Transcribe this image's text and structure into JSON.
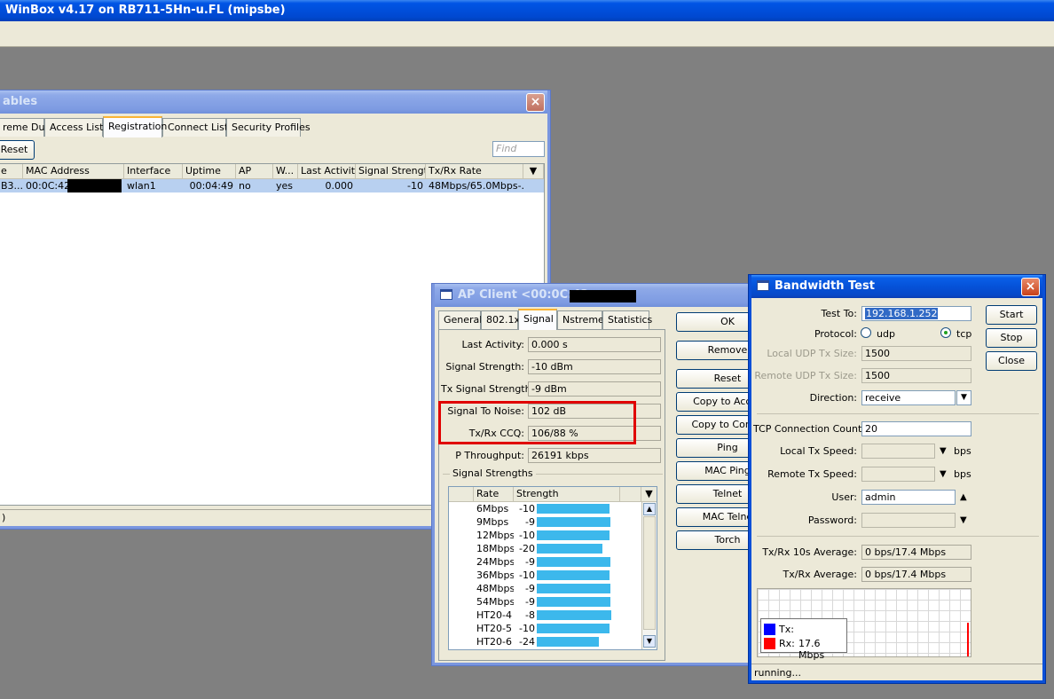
{
  "app": {
    "title": "WinBox v4.17 on RB711-5Hn-u.FL (mipsbe)"
  },
  "wireless_tables": {
    "title": "ables",
    "tabs": [
      "reme Dual",
      "Access List",
      "Registration",
      "Connect List",
      "Security Profiles"
    ],
    "active_tab": "Registration",
    "reset_label": "Reset",
    "find_placeholder": "Find",
    "columns": [
      "e",
      "MAC Address",
      "Interface",
      "Uptime",
      "AP",
      "W...",
      "Last Activit...",
      "Signal Strengt...",
      "Tx/Rx Rate"
    ],
    "row": {
      "radio": "B3...",
      "mac": "00:0C:42:",
      "interface": "wlan1",
      "uptime": "00:04:49",
      "ap": "no",
      "wds": "yes",
      "last_activity": "0.000",
      "signal": "-10",
      "rate": "48Mbps/65.0Mbps-..."
    },
    "status_text": ")"
  },
  "ap_client": {
    "title": "AP Client <00:0C:42:",
    "tabs": [
      "General",
      "802.1x",
      "Signal",
      "Nstreme",
      "Statistics"
    ],
    "active_tab": "Signal",
    "fields": {
      "last_activity_label": "Last Activity:",
      "last_activity": "0.000 s",
      "signal_strength_label": "Signal Strength:",
      "signal_strength": "-10 dBm",
      "tx_signal_label": "Tx Signal Strength:",
      "tx_signal": "-9 dBm",
      "snr_label": "Signal To Noise:",
      "snr": "102 dB",
      "ccq_label": "Tx/Rx CCQ:",
      "ccq": "106/88 %",
      "throughput_label": "P Throughput:",
      "throughput": "26191 kbps"
    },
    "signal_strengths_label": "Signal Strengths",
    "table_columns": [
      "Rate",
      "Strength"
    ],
    "rates": [
      {
        "rate": "6Mbps",
        "strength": "-10",
        "level": 0.97
      },
      {
        "rate": "9Mbps",
        "strength": "-9",
        "level": 0.98
      },
      {
        "rate": "12Mbps",
        "strength": "-10",
        "level": 0.97
      },
      {
        "rate": "18Mbps",
        "strength": "-20",
        "level": 0.87
      },
      {
        "rate": "24Mbps",
        "strength": "-9",
        "level": 0.98
      },
      {
        "rate": "36Mbps",
        "strength": "-10",
        "level": 0.97
      },
      {
        "rate": "48Mbps",
        "strength": "-9",
        "level": 0.98
      },
      {
        "rate": "54Mbps",
        "strength": "-9",
        "level": 0.98
      },
      {
        "rate": "HT20-4",
        "strength": "-8",
        "level": 0.99
      },
      {
        "rate": "HT20-5",
        "strength": "-10",
        "level": 0.97
      },
      {
        "rate": "HT20-6",
        "strength": "-24",
        "level": 0.82
      }
    ],
    "buttons": [
      "OK",
      "Remove",
      "Reset",
      "Copy to Acces",
      "Copy to Conne",
      "Ping",
      "MAC Ping",
      "Telnet",
      "MAC Telne",
      "Torch"
    ]
  },
  "bandwidth_test": {
    "title": "Bandwidth Test",
    "test_to_label": "Test To:",
    "test_to": "192.168.1.252",
    "protocol_label": "Protocol:",
    "udp_label": "udp",
    "tcp_label": "tcp",
    "protocol_selected": "tcp",
    "local_udp_label": "Local UDP Tx Size:",
    "local_udp": "1500",
    "remote_udp_label": "Remote UDP Tx Size:",
    "remote_udp": "1500",
    "direction_label": "Direction:",
    "direction": "receive",
    "tcp_count_label": "TCP Connection Count:",
    "tcp_count": "20",
    "local_speed_label": "Local Tx Speed:",
    "remote_speed_label": "Remote Tx Speed:",
    "bps": "bps",
    "user_label": "User:",
    "user": "admin",
    "password_label": "Password:",
    "avg10_label": "Tx/Rx 10s Average:",
    "avg10": "0 bps/17.4 Mbps",
    "avg_label": "Tx/Rx Average:",
    "avg": "0 bps/17.4 Mbps",
    "legend_tx": "Tx:",
    "legend_rx": "Rx:",
    "legend_rx_value": "17.6 Mbps",
    "tx_color": "#0000ff",
    "rx_color": "#ff0000",
    "buttons": [
      "Start",
      "Stop",
      "Close"
    ],
    "status": "running..."
  }
}
